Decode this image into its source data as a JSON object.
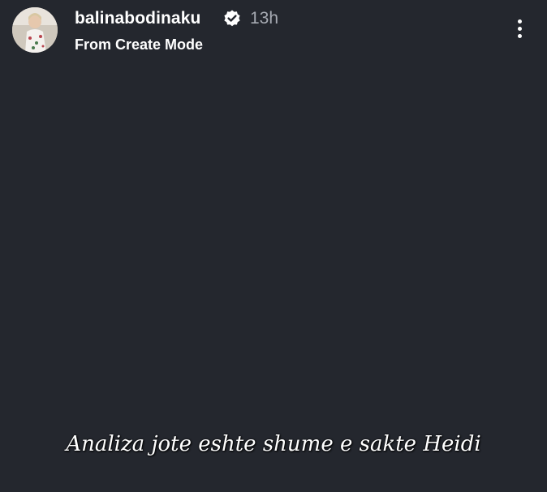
{
  "header": {
    "username": "balinabodinaku",
    "timestamp": "13h",
    "subtitle": "From Create Mode",
    "avatar_icon": "profile-photo",
    "verified_icon": "verified-badge-icon",
    "more_icon": "more-vertical-icon"
  },
  "story": {
    "background_color": "#24272e",
    "caption": "Analiza jote eshte shume e sakte Heidi"
  }
}
